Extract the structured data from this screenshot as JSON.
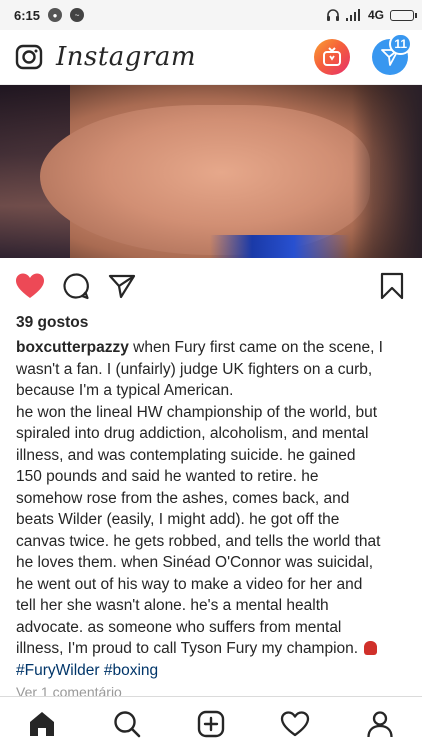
{
  "status_bar": {
    "time": "6:15",
    "network": "4G"
  },
  "header": {
    "app_title": "Instagram",
    "dm_badge_count": "11"
  },
  "post": {
    "likes_text": "39 gostos",
    "username": "boxcutterpazzy",
    "caption_lines": [
      "when Fury first came on the scene, I",
      "wasn't a fan. I (unfairly) judge UK fighters on a curb,",
      "because I'm a typical American.",
      "he won the lineal HW championship of the world, but",
      "spiraled into drug addiction, alcoholism, and mental",
      "illness, and was contemplating suicide. he gained",
      "150 pounds and said he wanted to retire. he",
      "somehow rose from the ashes, comes back, and",
      "beats Wilder (easily, I might add). he got off the",
      "canvas twice. he gets robbed, and tells the world that",
      "he loves them. when Sinéad O'Connor was suicidal,",
      "he went out of his way to make a video for her and",
      "tell her she wasn't alone. he's a mental health",
      "advocate. as someone who suffers from mental",
      "illness, I'm proud to call Tyson Fury my champion."
    ],
    "hashtags": "#FuryWilder #boxing",
    "view_comments": "Ver 1 comentário",
    "liked": true
  },
  "colors": {
    "like_red": "#ed4956",
    "dm_blue": "#3897f0",
    "hashtag": "#003569"
  },
  "icons": {
    "header": [
      "camera-icon",
      "igtv-icon",
      "direct-message-icon"
    ],
    "actions": [
      "heart-icon",
      "comment-icon",
      "share-icon",
      "bookmark-icon"
    ],
    "nav": [
      "home-icon",
      "search-icon",
      "add-post-icon",
      "activity-heart-icon",
      "profile-icon"
    ]
  }
}
